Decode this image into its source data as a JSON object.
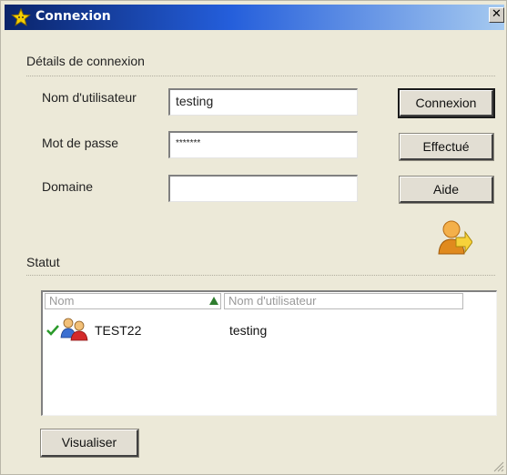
{
  "window": {
    "title": "Connexion",
    "icons": {
      "title": "star-icon",
      "close": "close-icon",
      "login_badge": "user-arrow-icon",
      "row_status": "check-icon",
      "row_user": "users-icon",
      "sort": "sort-ascending-icon"
    }
  },
  "details": {
    "section_label": "Détails de connexion",
    "username_label": "Nom d'utilisateur",
    "username_value": "testing",
    "password_label": "Mot de passe",
    "password_value": "*******",
    "domain_label": "Domaine",
    "domain_value": ""
  },
  "buttons": {
    "connect": "Connexion",
    "done": "Effectué",
    "help": "Aide",
    "view": "Visualiser"
  },
  "status": {
    "section_label": "Statut",
    "columns": [
      "Nom",
      "Nom d'utilisateur"
    ],
    "rows": [
      {
        "name": "TEST22",
        "username": "testing"
      }
    ]
  }
}
